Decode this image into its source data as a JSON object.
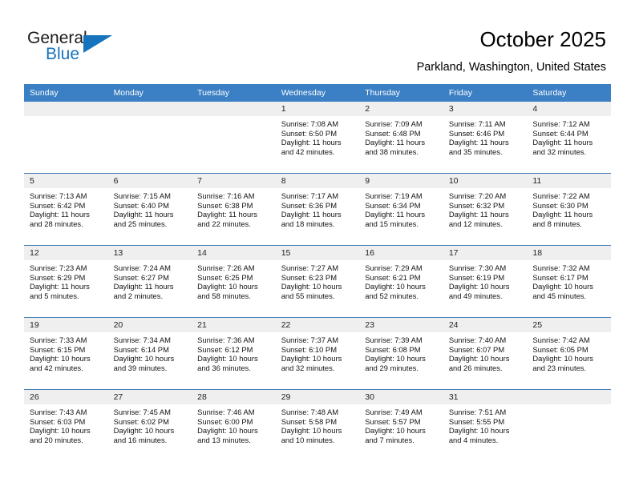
{
  "brand": {
    "name_part1": "General",
    "name_part2": "Blue",
    "accent_color": "#1673bd"
  },
  "header": {
    "title": "October 2025",
    "subtitle": "Parkland, Washington, United States"
  },
  "theme": {
    "header_row_color": "#3b7fc4",
    "daynum_band_color": "#efefef",
    "row_separator_color": "#4a7fb5"
  },
  "weekday_headers": [
    "Sunday",
    "Monday",
    "Tuesday",
    "Wednesday",
    "Thursday",
    "Friday",
    "Saturday"
  ],
  "weeks": [
    [
      {
        "day": "",
        "empty": true,
        "sunrise": "",
        "sunset": "",
        "daylight_line1": "",
        "daylight_line2": ""
      },
      {
        "day": "",
        "empty": true,
        "sunrise": "",
        "sunset": "",
        "daylight_line1": "",
        "daylight_line2": ""
      },
      {
        "day": "",
        "empty": true,
        "sunrise": "",
        "sunset": "",
        "daylight_line1": "",
        "daylight_line2": ""
      },
      {
        "day": "1",
        "empty": false,
        "sunrise": "Sunrise: 7:08 AM",
        "sunset": "Sunset: 6:50 PM",
        "daylight_line1": "Daylight: 11 hours",
        "daylight_line2": "and 42 minutes."
      },
      {
        "day": "2",
        "empty": false,
        "sunrise": "Sunrise: 7:09 AM",
        "sunset": "Sunset: 6:48 PM",
        "daylight_line1": "Daylight: 11 hours",
        "daylight_line2": "and 38 minutes."
      },
      {
        "day": "3",
        "empty": false,
        "sunrise": "Sunrise: 7:11 AM",
        "sunset": "Sunset: 6:46 PM",
        "daylight_line1": "Daylight: 11 hours",
        "daylight_line2": "and 35 minutes."
      },
      {
        "day": "4",
        "empty": false,
        "sunrise": "Sunrise: 7:12 AM",
        "sunset": "Sunset: 6:44 PM",
        "daylight_line1": "Daylight: 11 hours",
        "daylight_line2": "and 32 minutes."
      }
    ],
    [
      {
        "day": "5",
        "empty": false,
        "sunrise": "Sunrise: 7:13 AM",
        "sunset": "Sunset: 6:42 PM",
        "daylight_line1": "Daylight: 11 hours",
        "daylight_line2": "and 28 minutes."
      },
      {
        "day": "6",
        "empty": false,
        "sunrise": "Sunrise: 7:15 AM",
        "sunset": "Sunset: 6:40 PM",
        "daylight_line1": "Daylight: 11 hours",
        "daylight_line2": "and 25 minutes."
      },
      {
        "day": "7",
        "empty": false,
        "sunrise": "Sunrise: 7:16 AM",
        "sunset": "Sunset: 6:38 PM",
        "daylight_line1": "Daylight: 11 hours",
        "daylight_line2": "and 22 minutes."
      },
      {
        "day": "8",
        "empty": false,
        "sunrise": "Sunrise: 7:17 AM",
        "sunset": "Sunset: 6:36 PM",
        "daylight_line1": "Daylight: 11 hours",
        "daylight_line2": "and 18 minutes."
      },
      {
        "day": "9",
        "empty": false,
        "sunrise": "Sunrise: 7:19 AM",
        "sunset": "Sunset: 6:34 PM",
        "daylight_line1": "Daylight: 11 hours",
        "daylight_line2": "and 15 minutes."
      },
      {
        "day": "10",
        "empty": false,
        "sunrise": "Sunrise: 7:20 AM",
        "sunset": "Sunset: 6:32 PM",
        "daylight_line1": "Daylight: 11 hours",
        "daylight_line2": "and 12 minutes."
      },
      {
        "day": "11",
        "empty": false,
        "sunrise": "Sunrise: 7:22 AM",
        "sunset": "Sunset: 6:30 PM",
        "daylight_line1": "Daylight: 11 hours",
        "daylight_line2": "and 8 minutes."
      }
    ],
    [
      {
        "day": "12",
        "empty": false,
        "sunrise": "Sunrise: 7:23 AM",
        "sunset": "Sunset: 6:29 PM",
        "daylight_line1": "Daylight: 11 hours",
        "daylight_line2": "and 5 minutes."
      },
      {
        "day": "13",
        "empty": false,
        "sunrise": "Sunrise: 7:24 AM",
        "sunset": "Sunset: 6:27 PM",
        "daylight_line1": "Daylight: 11 hours",
        "daylight_line2": "and 2 minutes."
      },
      {
        "day": "14",
        "empty": false,
        "sunrise": "Sunrise: 7:26 AM",
        "sunset": "Sunset: 6:25 PM",
        "daylight_line1": "Daylight: 10 hours",
        "daylight_line2": "and 58 minutes."
      },
      {
        "day": "15",
        "empty": false,
        "sunrise": "Sunrise: 7:27 AM",
        "sunset": "Sunset: 6:23 PM",
        "daylight_line1": "Daylight: 10 hours",
        "daylight_line2": "and 55 minutes."
      },
      {
        "day": "16",
        "empty": false,
        "sunrise": "Sunrise: 7:29 AM",
        "sunset": "Sunset: 6:21 PM",
        "daylight_line1": "Daylight: 10 hours",
        "daylight_line2": "and 52 minutes."
      },
      {
        "day": "17",
        "empty": false,
        "sunrise": "Sunrise: 7:30 AM",
        "sunset": "Sunset: 6:19 PM",
        "daylight_line1": "Daylight: 10 hours",
        "daylight_line2": "and 49 minutes."
      },
      {
        "day": "18",
        "empty": false,
        "sunrise": "Sunrise: 7:32 AM",
        "sunset": "Sunset: 6:17 PM",
        "daylight_line1": "Daylight: 10 hours",
        "daylight_line2": "and 45 minutes."
      }
    ],
    [
      {
        "day": "19",
        "empty": false,
        "sunrise": "Sunrise: 7:33 AM",
        "sunset": "Sunset: 6:15 PM",
        "daylight_line1": "Daylight: 10 hours",
        "daylight_line2": "and 42 minutes."
      },
      {
        "day": "20",
        "empty": false,
        "sunrise": "Sunrise: 7:34 AM",
        "sunset": "Sunset: 6:14 PM",
        "daylight_line1": "Daylight: 10 hours",
        "daylight_line2": "and 39 minutes."
      },
      {
        "day": "21",
        "empty": false,
        "sunrise": "Sunrise: 7:36 AM",
        "sunset": "Sunset: 6:12 PM",
        "daylight_line1": "Daylight: 10 hours",
        "daylight_line2": "and 36 minutes."
      },
      {
        "day": "22",
        "empty": false,
        "sunrise": "Sunrise: 7:37 AM",
        "sunset": "Sunset: 6:10 PM",
        "daylight_line1": "Daylight: 10 hours",
        "daylight_line2": "and 32 minutes."
      },
      {
        "day": "23",
        "empty": false,
        "sunrise": "Sunrise: 7:39 AM",
        "sunset": "Sunset: 6:08 PM",
        "daylight_line1": "Daylight: 10 hours",
        "daylight_line2": "and 29 minutes."
      },
      {
        "day": "24",
        "empty": false,
        "sunrise": "Sunrise: 7:40 AM",
        "sunset": "Sunset: 6:07 PM",
        "daylight_line1": "Daylight: 10 hours",
        "daylight_line2": "and 26 minutes."
      },
      {
        "day": "25",
        "empty": false,
        "sunrise": "Sunrise: 7:42 AM",
        "sunset": "Sunset: 6:05 PM",
        "daylight_line1": "Daylight: 10 hours",
        "daylight_line2": "and 23 minutes."
      }
    ],
    [
      {
        "day": "26",
        "empty": false,
        "sunrise": "Sunrise: 7:43 AM",
        "sunset": "Sunset: 6:03 PM",
        "daylight_line1": "Daylight: 10 hours",
        "daylight_line2": "and 20 minutes."
      },
      {
        "day": "27",
        "empty": false,
        "sunrise": "Sunrise: 7:45 AM",
        "sunset": "Sunset: 6:02 PM",
        "daylight_line1": "Daylight: 10 hours",
        "daylight_line2": "and 16 minutes."
      },
      {
        "day": "28",
        "empty": false,
        "sunrise": "Sunrise: 7:46 AM",
        "sunset": "Sunset: 6:00 PM",
        "daylight_line1": "Daylight: 10 hours",
        "daylight_line2": "and 13 minutes."
      },
      {
        "day": "29",
        "empty": false,
        "sunrise": "Sunrise: 7:48 AM",
        "sunset": "Sunset: 5:58 PM",
        "daylight_line1": "Daylight: 10 hours",
        "daylight_line2": "and 10 minutes."
      },
      {
        "day": "30",
        "empty": false,
        "sunrise": "Sunrise: 7:49 AM",
        "sunset": "Sunset: 5:57 PM",
        "daylight_line1": "Daylight: 10 hours",
        "daylight_line2": "and 7 minutes."
      },
      {
        "day": "31",
        "empty": false,
        "sunrise": "Sunrise: 7:51 AM",
        "sunset": "Sunset: 5:55 PM",
        "daylight_line1": "Daylight: 10 hours",
        "daylight_line2": "and 4 minutes."
      },
      {
        "day": "",
        "empty": true,
        "sunrise": "",
        "sunset": "",
        "daylight_line1": "",
        "daylight_line2": ""
      }
    ]
  ]
}
